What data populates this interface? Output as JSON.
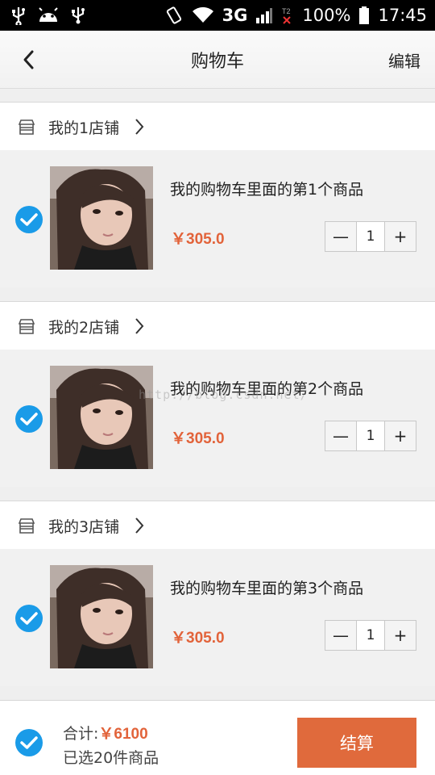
{
  "status_bar": {
    "network": "3G",
    "battery": "100%",
    "time": "17:45"
  },
  "header": {
    "title": "购物车",
    "edit_label": "编辑"
  },
  "shops": [
    {
      "name": "我的1店铺",
      "item": {
        "title": "我的购物车里面的第1个商品",
        "price": "￥305.0",
        "quantity": "1",
        "checked": true
      }
    },
    {
      "name": "我的2店铺",
      "item": {
        "title": "我的购物车里面的第2个商品",
        "price": "￥305.0",
        "quantity": "1",
        "checked": true
      }
    },
    {
      "name": "我的3店铺",
      "item": {
        "title": "我的购物车里面的第3个商品",
        "price": "￥305.0",
        "quantity": "1",
        "checked": true
      }
    }
  ],
  "stepper": {
    "minus": "—",
    "plus": "+"
  },
  "watermark": "http://blog.csdn.net/",
  "footer": {
    "total_label": "合计:",
    "total_amount": "￥6100",
    "selected_text": "已选20件商品",
    "checkout_label": "结算",
    "all_checked": true
  },
  "colors": {
    "accent": "#e2633a",
    "checkout": "#e06a3c",
    "check": "#1a9be8"
  }
}
